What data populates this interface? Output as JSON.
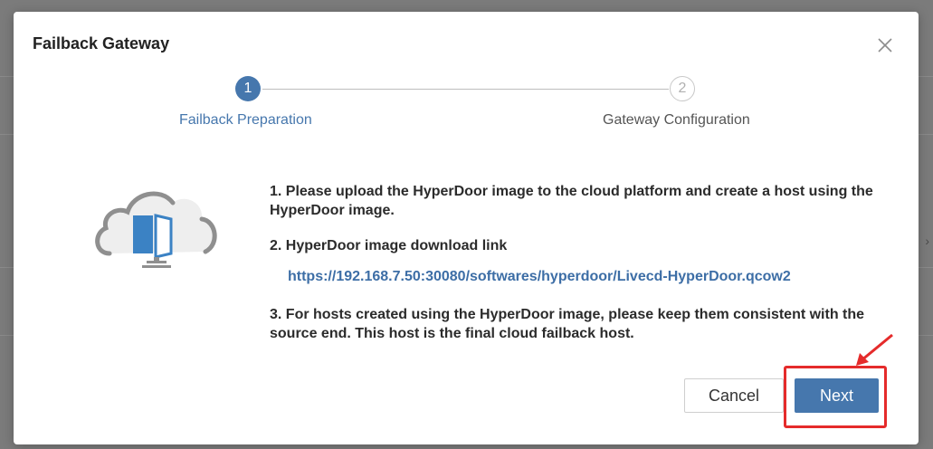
{
  "dialog": {
    "title": "Failback Gateway",
    "close_icon": "close-icon"
  },
  "stepper": {
    "steps": [
      {
        "number": "1",
        "label": "Failback Preparation",
        "state": "active"
      },
      {
        "number": "2",
        "label": "Gateway Configuration",
        "state": "pending"
      }
    ]
  },
  "illustration": {
    "icon": "cloud-server-icon"
  },
  "instructions": {
    "step1": "1. Please upload the HyperDoor image to the cloud platform and create a host using the HyperDoor image.",
    "step2": "2. HyperDoor image download link",
    "download_link": "https://192.168.7.50:30080/softwares/hyperdoor/Livecd-HyperDoor.qcow2",
    "step3": "3. For hosts created using the HyperDoor image, please keep them consistent with the source end. This host is the final cloud failback host."
  },
  "footer": {
    "cancel_label": "Cancel",
    "next_label": "Next"
  },
  "colors": {
    "primary": "#4677ad",
    "annotation": "#e52b2b"
  }
}
